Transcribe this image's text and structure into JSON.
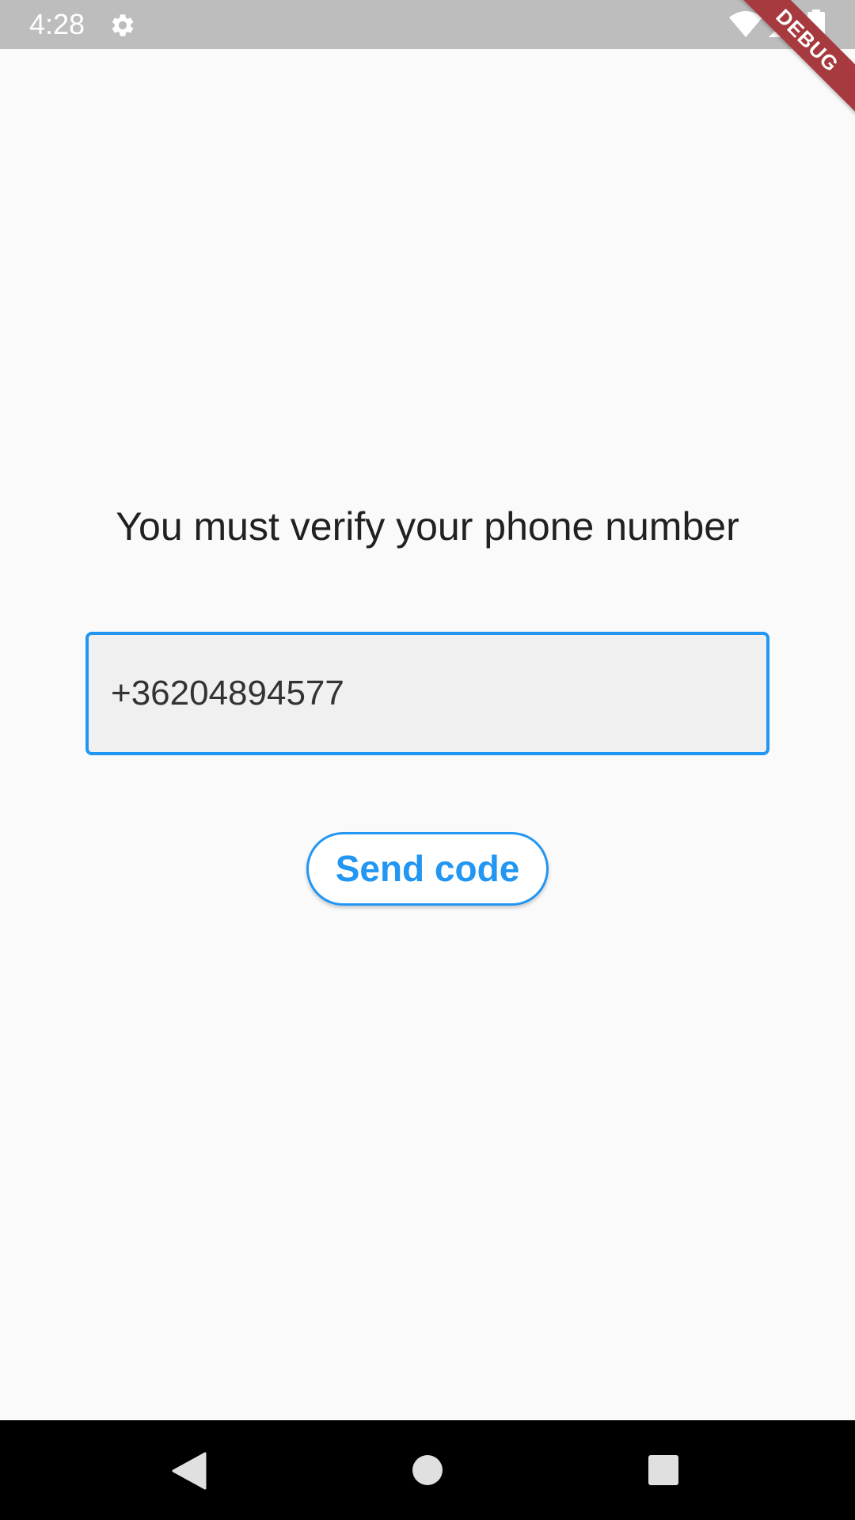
{
  "status_bar": {
    "time": "4:28",
    "icons": [
      "gear-icon",
      "wifi-icon",
      "signal-icon",
      "battery-icon"
    ]
  },
  "debug_banner": {
    "label": "DEBUG",
    "color": "#a63a3f"
  },
  "main": {
    "heading": "You must verify your phone number",
    "phone_field": {
      "value": "+36204894577",
      "placeholder": ""
    },
    "send_button_label": "Send code"
  },
  "nav_bar": {
    "icons": [
      "back-icon",
      "home-icon",
      "recents-icon"
    ]
  },
  "colors": {
    "accent": "#2196f3",
    "background": "#fafafa",
    "status_bar": "#bdbdbd",
    "field_fill": "#f0f0f0"
  }
}
